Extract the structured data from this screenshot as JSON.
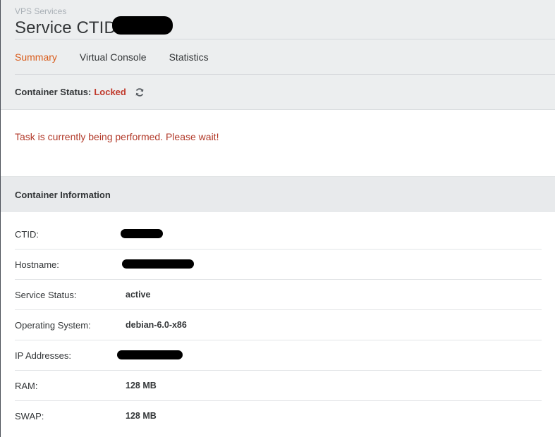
{
  "header": {
    "breadcrumb": "VPS Services",
    "title": "Service CTID"
  },
  "tabs": [
    {
      "label": "Summary",
      "active": true
    },
    {
      "label": "Virtual Console",
      "active": false
    },
    {
      "label": "Statistics",
      "active": false
    }
  ],
  "status": {
    "label": "Container Status:",
    "value": "Locked",
    "value_color": "#c0392b",
    "icon": "refresh-icon"
  },
  "alert": {
    "message": "Task is currently being performed. Please wait!"
  },
  "container_info": {
    "heading": "Container Information",
    "rows": [
      {
        "label": "CTID:",
        "value": "",
        "redacted": true
      },
      {
        "label": "Hostname:",
        "value": "",
        "redacted": true
      },
      {
        "label": "Service Status:",
        "value": "active",
        "redacted": false
      },
      {
        "label": "Operating System:",
        "value": "debian-6.0-x86",
        "redacted": false
      },
      {
        "label": "IP Addresses:",
        "value": "",
        "redacted": true
      },
      {
        "label": "RAM:",
        "value": "128 MB",
        "redacted": false
      },
      {
        "label": "SWAP:",
        "value": "128 MB",
        "redacted": false
      }
    ]
  },
  "colors": {
    "accent": "#d95b1a",
    "error": "#b23a2a",
    "panel": "#eceeef"
  }
}
